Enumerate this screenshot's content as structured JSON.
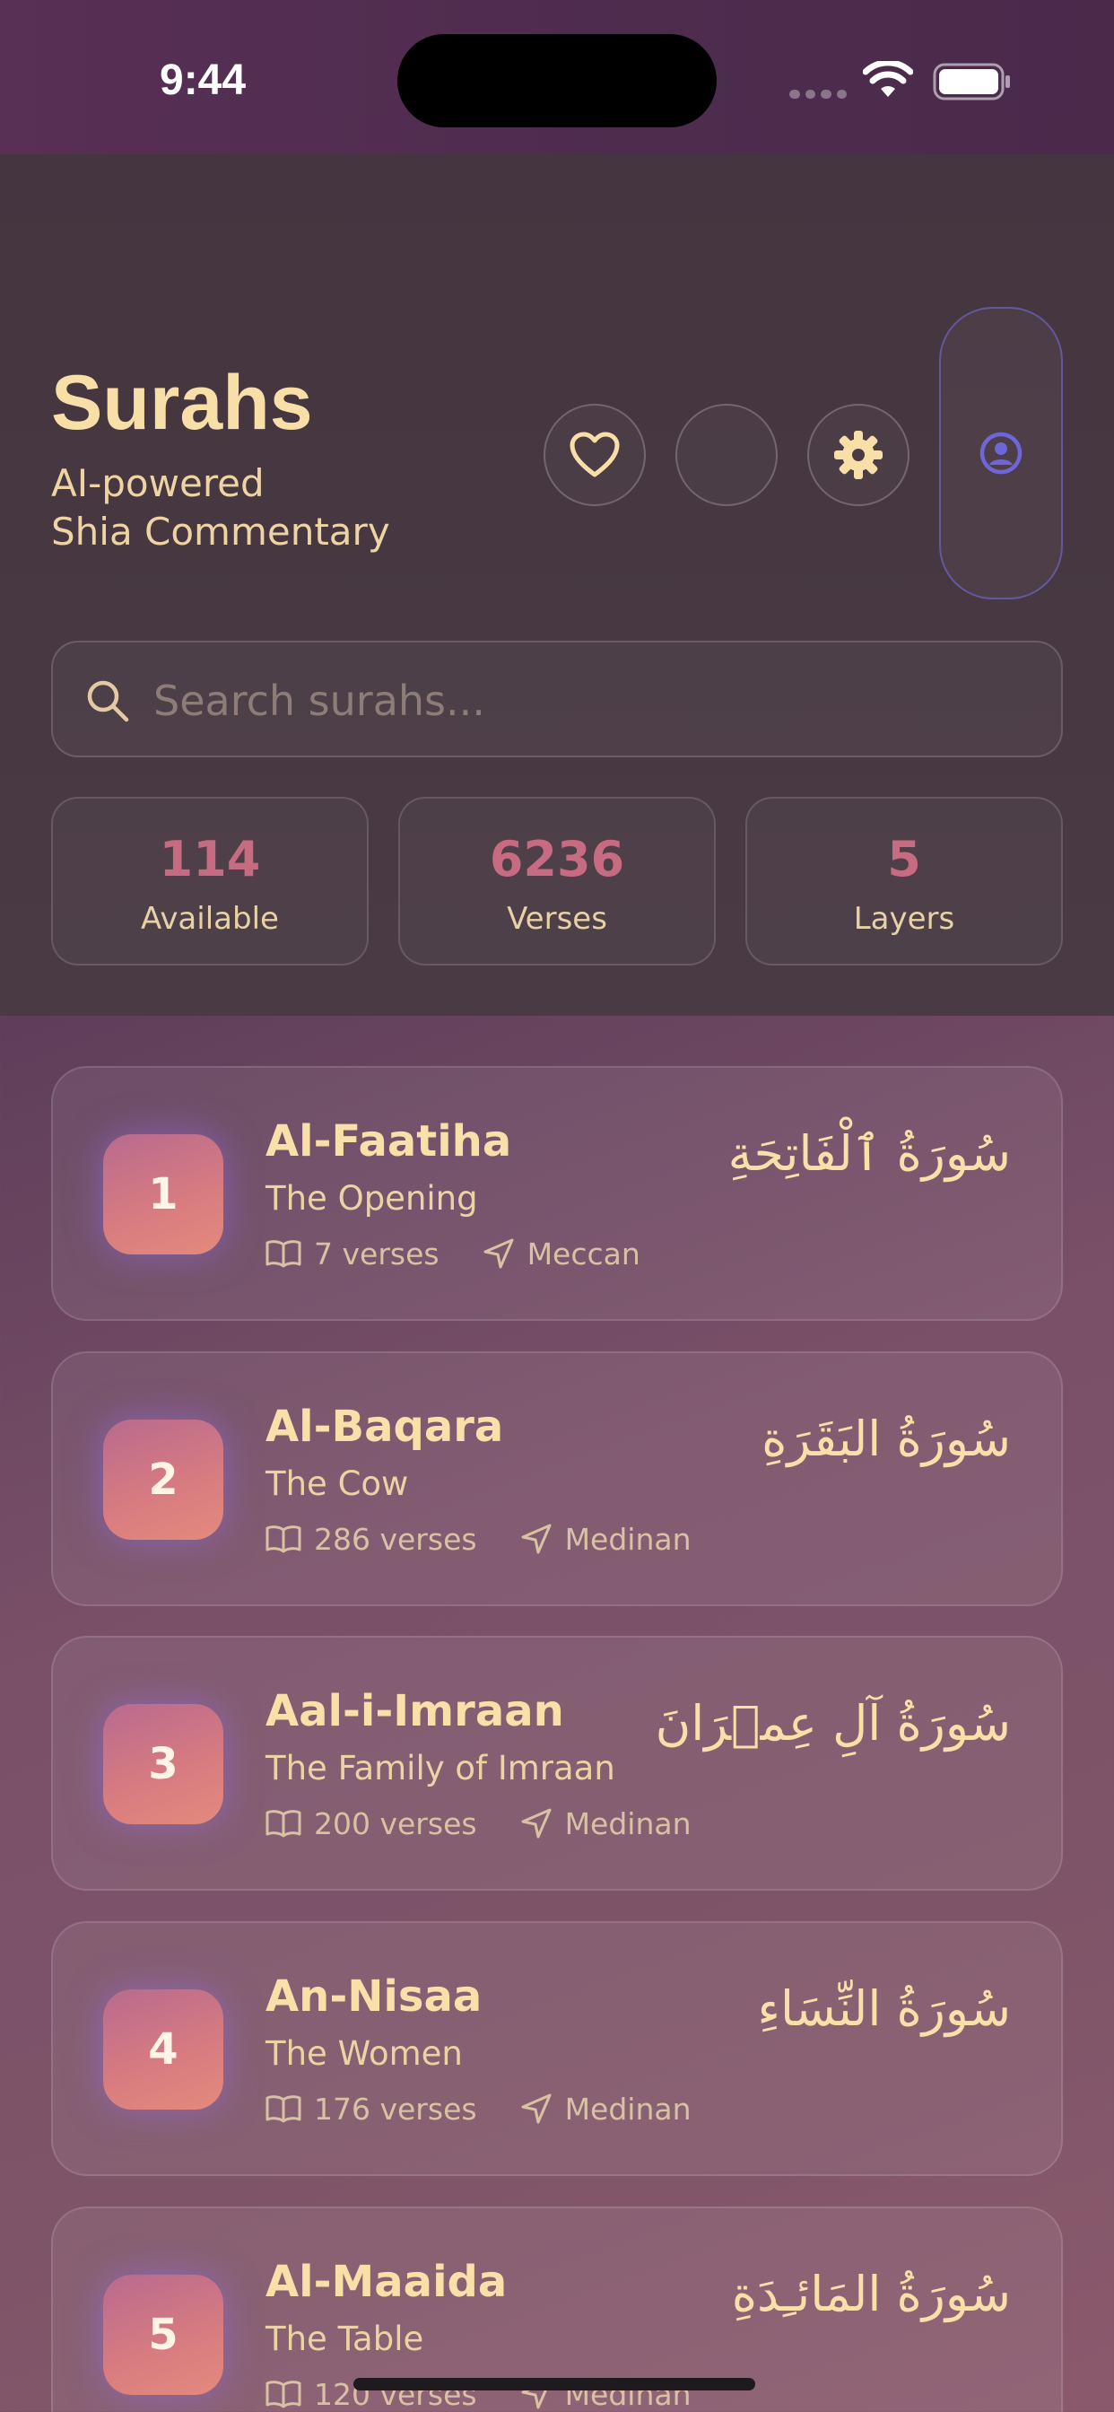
{
  "status_bar": {
    "time": "9:44"
  },
  "header": {
    "title": "Surahs",
    "subtitle_line1": "AI-powered",
    "subtitle_line2": "Shia Commentary",
    "search_placeholder": "Search surahs..."
  },
  "stats": [
    {
      "value": "114",
      "label": "Available",
      "color": "#c86a84"
    },
    {
      "value": "6236",
      "label": "Verses",
      "color": "#c86a84"
    },
    {
      "value": "5",
      "label": "Layers",
      "color": "#c86a84"
    }
  ],
  "colors": {
    "accent_profile": "#6c66d8",
    "title": "#f8dfa8"
  },
  "surahs": [
    {
      "number": "1",
      "name": "Al-Faatiha",
      "meaning": "The Opening",
      "verses": "7 verses",
      "place": "Meccan",
      "arabic": "سُورَةُ ٱلْفَاتِحَةِ"
    },
    {
      "number": "2",
      "name": "Al-Baqara",
      "meaning": "The Cow",
      "verses": "286 verses",
      "place": "Medinan",
      "arabic": "سُورَةُ البَقَرَةِ"
    },
    {
      "number": "3",
      "name": "Aal-i-Imraan",
      "meaning": "The Family of Imraan",
      "verses": "200 verses",
      "place": "Medinan",
      "arabic": "سُورَةُ آلِ عِمۡرَانَ"
    },
    {
      "number": "4",
      "name": "An-Nisaa",
      "meaning": "The Women",
      "verses": "176 verses",
      "place": "Medinan",
      "arabic": "سُورَةُ النِّسَاءِ"
    },
    {
      "number": "5",
      "name": "Al-Maaida",
      "meaning": "The Table",
      "verses": "120 verses",
      "place": "Medinan",
      "arabic": "سُورَةُ المَائـِدَةِ"
    }
  ]
}
